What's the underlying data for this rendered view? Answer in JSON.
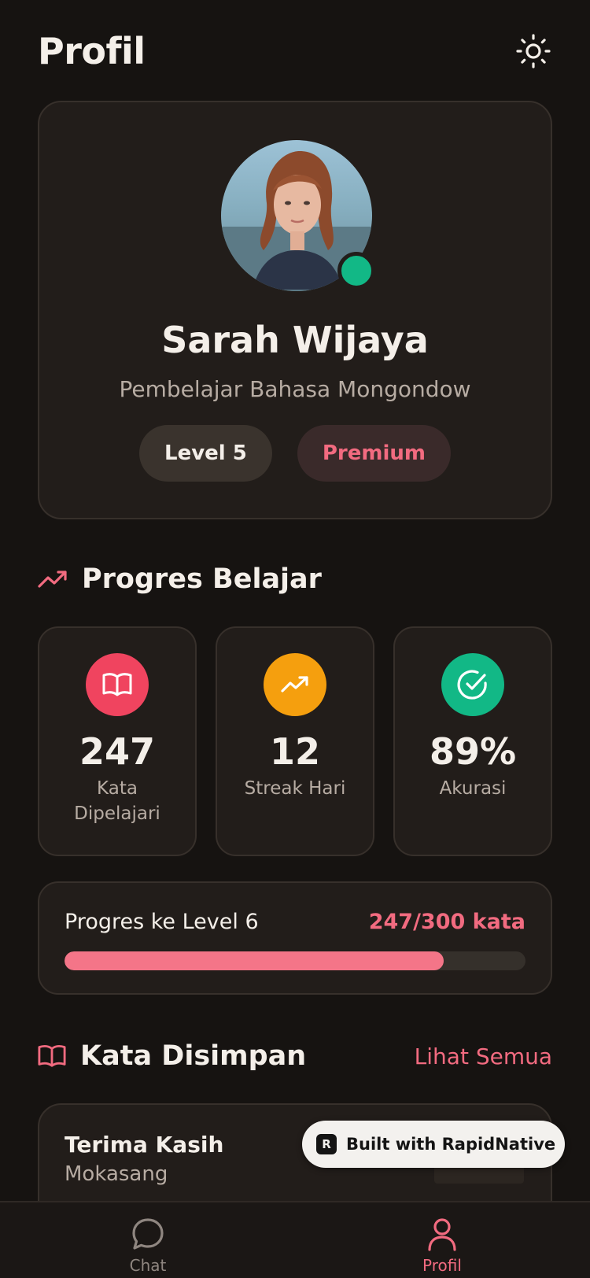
{
  "header": {
    "title": "Profil",
    "theme_icon": "sun-icon"
  },
  "profile": {
    "name": "Sarah Wijaya",
    "subtitle": "Pembelajar Bahasa Mongondow",
    "status": "online",
    "badges": {
      "level": "Level 5",
      "premium": "Premium"
    }
  },
  "progress_section": {
    "title": "Progres Belajar",
    "icon": "trending-up-icon",
    "stats": [
      {
        "value": "247",
        "label": "Kata Dipelajari",
        "icon": "book-open-icon",
        "color": "#f0445f"
      },
      {
        "value": "12",
        "label": "Streak Hari",
        "icon": "trending-up-icon",
        "color": "#f59f0e"
      },
      {
        "value": "89%",
        "label": "Akurasi",
        "icon": "check-circle-icon",
        "color": "#12b886"
      }
    ],
    "level_progress": {
      "label": "Progres ke Level 6",
      "count": "247/300 kata",
      "fraction": 0.823
    }
  },
  "saved_section": {
    "title": "Kata Disimpan",
    "icon": "book-open-icon",
    "see_all": "Lihat Semua",
    "items": [
      {
        "word": "Terima Kasih",
        "translation": "Mokasang"
      }
    ]
  },
  "built_badge": {
    "text": "Built with RapidNative"
  },
  "tabbar": {
    "tabs": [
      {
        "label": "Chat",
        "icon": "chat-bubble-icon",
        "active": false
      },
      {
        "label": "Profil",
        "icon": "user-icon",
        "active": true
      }
    ]
  },
  "colors": {
    "accent": "#f26b80",
    "background": "#161311",
    "card": "#221d1a",
    "online": "#12b886"
  }
}
